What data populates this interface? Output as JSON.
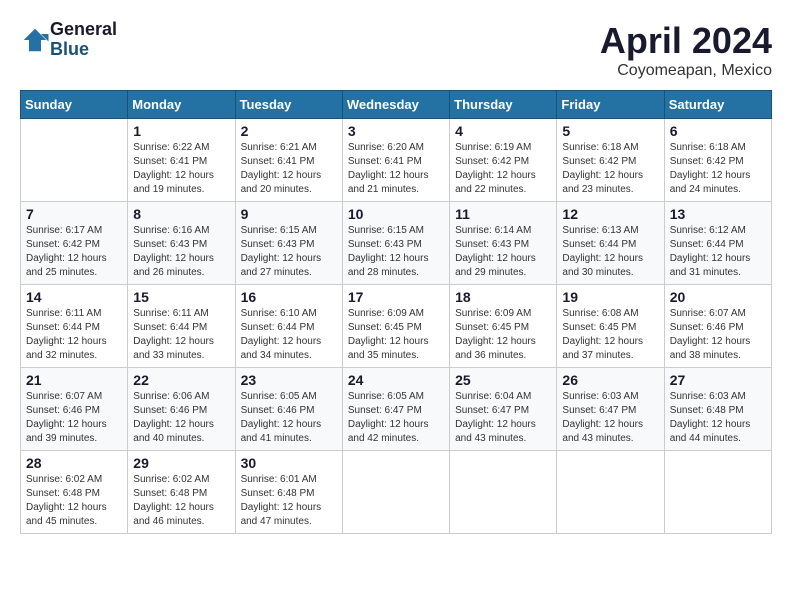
{
  "header": {
    "logo_general": "General",
    "logo_blue": "Blue",
    "title": "April 2024",
    "subtitle": "Coyomeapan, Mexico"
  },
  "days_of_week": [
    "Sunday",
    "Monday",
    "Tuesday",
    "Wednesday",
    "Thursday",
    "Friday",
    "Saturday"
  ],
  "weeks": [
    [
      null,
      {
        "day": "1",
        "sunrise": "6:22 AM",
        "sunset": "6:41 PM",
        "daylight": "12 hours and 19 minutes."
      },
      {
        "day": "2",
        "sunrise": "6:21 AM",
        "sunset": "6:41 PM",
        "daylight": "12 hours and 20 minutes."
      },
      {
        "day": "3",
        "sunrise": "6:20 AM",
        "sunset": "6:41 PM",
        "daylight": "12 hours and 21 minutes."
      },
      {
        "day": "4",
        "sunrise": "6:19 AM",
        "sunset": "6:42 PM",
        "daylight": "12 hours and 22 minutes."
      },
      {
        "day": "5",
        "sunrise": "6:18 AM",
        "sunset": "6:42 PM",
        "daylight": "12 hours and 23 minutes."
      },
      {
        "day": "6",
        "sunrise": "6:18 AM",
        "sunset": "6:42 PM",
        "daylight": "12 hours and 24 minutes."
      }
    ],
    [
      {
        "day": "7",
        "sunrise": "6:17 AM",
        "sunset": "6:42 PM",
        "daylight": "12 hours and 25 minutes."
      },
      {
        "day": "8",
        "sunrise": "6:16 AM",
        "sunset": "6:43 PM",
        "daylight": "12 hours and 26 minutes."
      },
      {
        "day": "9",
        "sunrise": "6:15 AM",
        "sunset": "6:43 PM",
        "daylight": "12 hours and 27 minutes."
      },
      {
        "day": "10",
        "sunrise": "6:15 AM",
        "sunset": "6:43 PM",
        "daylight": "12 hours and 28 minutes."
      },
      {
        "day": "11",
        "sunrise": "6:14 AM",
        "sunset": "6:43 PM",
        "daylight": "12 hours and 29 minutes."
      },
      {
        "day": "12",
        "sunrise": "6:13 AM",
        "sunset": "6:44 PM",
        "daylight": "12 hours and 30 minutes."
      },
      {
        "day": "13",
        "sunrise": "6:12 AM",
        "sunset": "6:44 PM",
        "daylight": "12 hours and 31 minutes."
      }
    ],
    [
      {
        "day": "14",
        "sunrise": "6:11 AM",
        "sunset": "6:44 PM",
        "daylight": "12 hours and 32 minutes."
      },
      {
        "day": "15",
        "sunrise": "6:11 AM",
        "sunset": "6:44 PM",
        "daylight": "12 hours and 33 minutes."
      },
      {
        "day": "16",
        "sunrise": "6:10 AM",
        "sunset": "6:44 PM",
        "daylight": "12 hours and 34 minutes."
      },
      {
        "day": "17",
        "sunrise": "6:09 AM",
        "sunset": "6:45 PM",
        "daylight": "12 hours and 35 minutes."
      },
      {
        "day": "18",
        "sunrise": "6:09 AM",
        "sunset": "6:45 PM",
        "daylight": "12 hours and 36 minutes."
      },
      {
        "day": "19",
        "sunrise": "6:08 AM",
        "sunset": "6:45 PM",
        "daylight": "12 hours and 37 minutes."
      },
      {
        "day": "20",
        "sunrise": "6:07 AM",
        "sunset": "6:46 PM",
        "daylight": "12 hours and 38 minutes."
      }
    ],
    [
      {
        "day": "21",
        "sunrise": "6:07 AM",
        "sunset": "6:46 PM",
        "daylight": "12 hours and 39 minutes."
      },
      {
        "day": "22",
        "sunrise": "6:06 AM",
        "sunset": "6:46 PM",
        "daylight": "12 hours and 40 minutes."
      },
      {
        "day": "23",
        "sunrise": "6:05 AM",
        "sunset": "6:46 PM",
        "daylight": "12 hours and 41 minutes."
      },
      {
        "day": "24",
        "sunrise": "6:05 AM",
        "sunset": "6:47 PM",
        "daylight": "12 hours and 42 minutes."
      },
      {
        "day": "25",
        "sunrise": "6:04 AM",
        "sunset": "6:47 PM",
        "daylight": "12 hours and 43 minutes."
      },
      {
        "day": "26",
        "sunrise": "6:03 AM",
        "sunset": "6:47 PM",
        "daylight": "12 hours and 43 minutes."
      },
      {
        "day": "27",
        "sunrise": "6:03 AM",
        "sunset": "6:48 PM",
        "daylight": "12 hours and 44 minutes."
      }
    ],
    [
      {
        "day": "28",
        "sunrise": "6:02 AM",
        "sunset": "6:48 PM",
        "daylight": "12 hours and 45 minutes."
      },
      {
        "day": "29",
        "sunrise": "6:02 AM",
        "sunset": "6:48 PM",
        "daylight": "12 hours and 46 minutes."
      },
      {
        "day": "30",
        "sunrise": "6:01 AM",
        "sunset": "6:48 PM",
        "daylight": "12 hours and 47 minutes."
      },
      null,
      null,
      null,
      null
    ]
  ],
  "labels": {
    "sunrise_prefix": "Sunrise: ",
    "sunset_prefix": "Sunset: ",
    "daylight_prefix": "Daylight: "
  }
}
